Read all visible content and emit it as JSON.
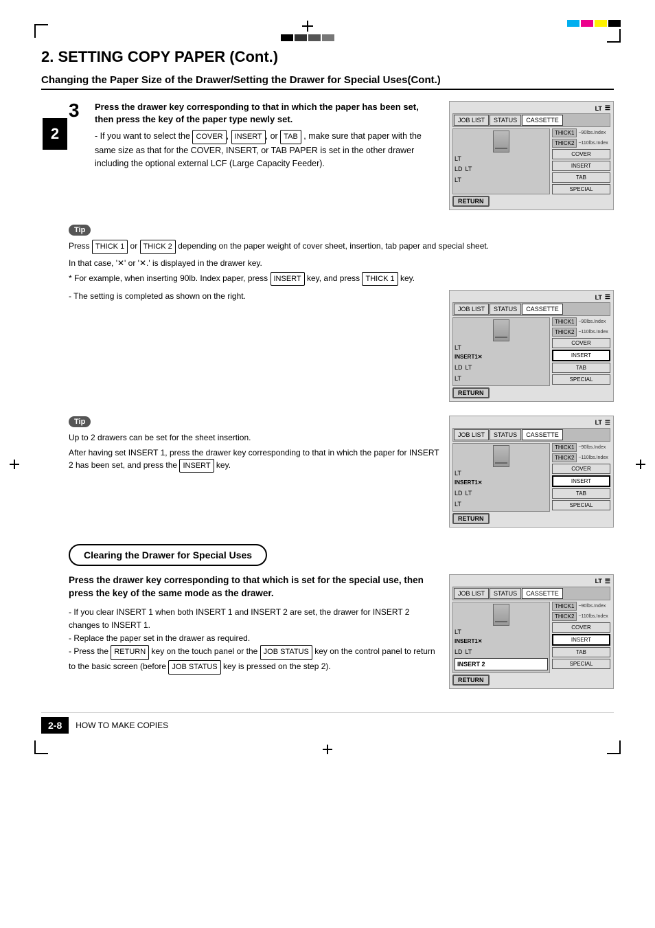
{
  "page": {
    "section_title": "2. SETTING COPY PAPER (Cont.)",
    "subsection_title": "Changing the Paper Size of the Drawer/Setting the Drawer for Special Uses(Cont.)",
    "chapter_number": "2",
    "footer_page": "2-8",
    "footer_text": "HOW TO MAKE COPIES"
  },
  "step3": {
    "number": "3",
    "heading": "Press the drawer key corresponding to that in which the paper has been set, then press the key of the paper type newly set.",
    "body": "- If you want to select the  COVER ,  INSERT , or  TAB , make sure that paper with the same size as that for the COVER, INSERT, or TAB PAPER is set in the other drawer including the optional external LCF (Large Capacity Feeder)."
  },
  "tip1": {
    "label": "Tip",
    "lines": [
      "Press  THICK 1  or  THICK 2  depending on the paper weight of cover sheet, insertion, tab paper and special sheet.",
      "In that case, '✕' or '✕.' is displayed in the drawer key.",
      "* For example, when inserting 90lb. Index paper, press  INSERT  key, and press  THICK 1  key.",
      "- The setting is completed as shown on the right."
    ]
  },
  "tip2": {
    "label": "Tip",
    "lines": [
      "Up to 2 drawers can be set for the sheet insertion.",
      "After having set INSERT 1,  press the drawer key corresponding to that in which the paper for INSERT 2 has been set, and press the  INSERT  key."
    ]
  },
  "clearing": {
    "box_title": "Clearing the Drawer for Special Uses",
    "heading": "Press the drawer key corresponding to that which is set for the special use, then press the key of the same mode as the drawer.",
    "items": [
      "- If you clear INSERT 1 when both INSERT 1 and INSERT 2 are set, the drawer for INSERT 2 changes to INSERT 1.",
      "- Replace the paper set in the drawer as required.",
      "- Press the  RETURN  key on the touch panel or the  JOB STATUS  key on the control panel to return to the basic screen (before  JOB STATUS  key is pressed on the step 2)."
    ]
  },
  "panels": {
    "lt_label": "LT",
    "buttons": {
      "job_list": "JOB LIST",
      "status": "STATUS",
      "cassette": "CASSETTE",
      "thick1": "THICK1",
      "thick1_desc": "~90lbs.Index",
      "thick2": "THICK2",
      "thick2_desc": "~110lbs.Index",
      "cover": "COVER",
      "insert": "INSERT",
      "tab": "TAB",
      "special": "SPECIAL",
      "return_label": "RETURN",
      "ld": "LD",
      "lt": "LT",
      "insert1": "INSERT1✕",
      "insert2": "INSERT 2"
    }
  }
}
